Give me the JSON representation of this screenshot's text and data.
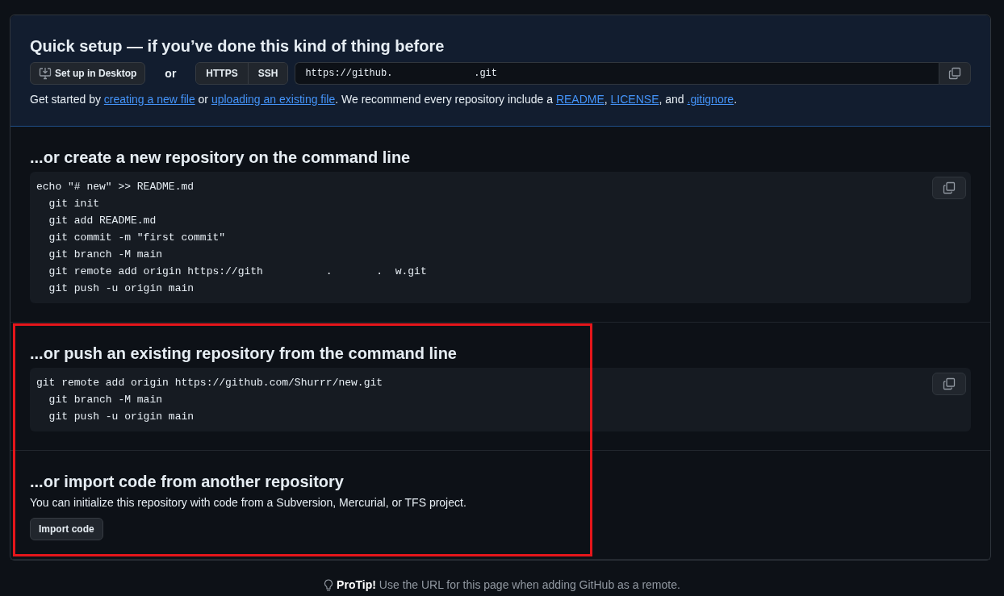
{
  "quick_setup": {
    "title": "Quick setup — if you’ve done this kind of thing before",
    "desktop_button": "Set up in Desktop",
    "or": "or",
    "protocols": [
      "HTTPS",
      "SSH"
    ],
    "url": "https://github.              .git",
    "intro": [
      "Get started by ",
      "creating a new file",
      " or ",
      "uploading an existing file",
      ". We recommend every repository include a ",
      "README",
      ", ",
      "LICENSE",
      ", and ",
      ".gitignore",
      "."
    ]
  },
  "sections": [
    {
      "title": "...or create a new repository on the command line",
      "lines": [
        "echo \"# new\" >> README.md",
        "  git init",
        "  git add README.md",
        "  git commit -m \"first commit\"",
        "  git branch -M main",
        "  git remote add origin https://gith          .       .  w.git",
        "  git push -u origin main"
      ]
    },
    {
      "title": "...or push an existing repository from the command line",
      "lines": [
        "git remote add origin https://github.com/Shurrr/new.git",
        "  git branch -M main",
        "  git push -u origin main"
      ]
    }
  ],
  "import": {
    "title": "...or import code from another repository",
    "text": "You can initialize this repository with code from a Subversion, Mercurial, or TFS project.",
    "button": "Import code"
  },
  "highlight_box": true,
  "protip": {
    "label": "ProTip!",
    "text": "Use the URL for this page when adding GitHub as a remote."
  }
}
